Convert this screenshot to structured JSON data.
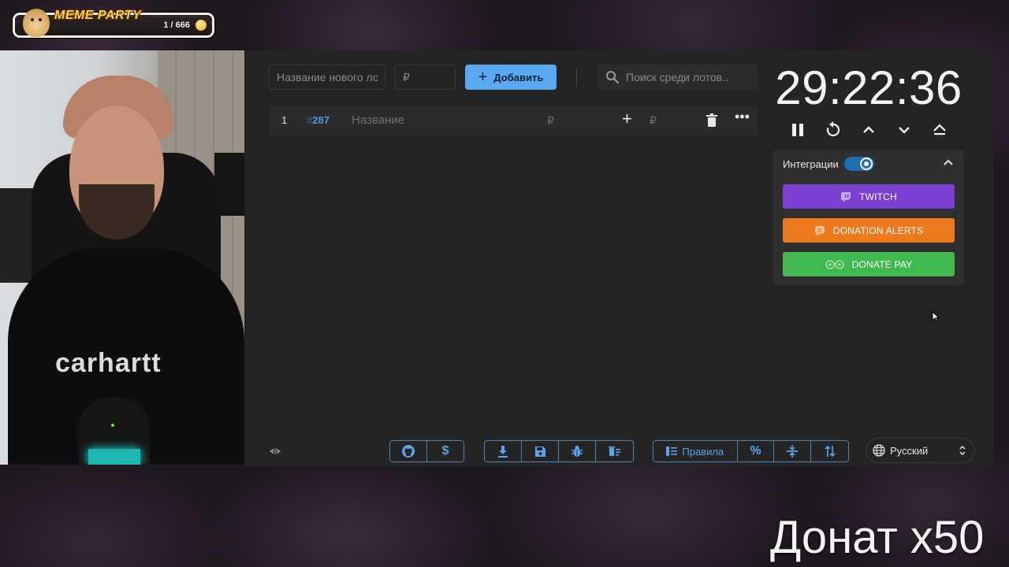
{
  "overlay": {
    "brand": "MEME PARTY",
    "counter": "1 / 666"
  },
  "webcam": {
    "shirt_logo": "carhartt"
  },
  "toolbar": {
    "name_placeholder": "Название нового лота",
    "price_placeholder": "₽",
    "add_label": "Добавить",
    "search_placeholder": "Поиск среди лотов.."
  },
  "lots": [
    {
      "number": "1",
      "id_hash": "#",
      "id": "287",
      "name_placeholder": "Название",
      "amount_placeholder": "₽",
      "add_amount_placeholder": "₽"
    }
  ],
  "timer": {
    "value": "29:22:36"
  },
  "integrations": {
    "title": "Интеграции",
    "enabled": true,
    "buttons": [
      {
        "label": "TWITCH",
        "color": "#7b3fd2"
      },
      {
        "label": "DONATION ALERTS",
        "color": "#ea7a1c"
      },
      {
        "label": "DONATE PAY",
        "color": "#3fb84f"
      }
    ]
  },
  "footer": {
    "rules_label": "Правила",
    "language": "Русский"
  },
  "caption": "Донат x50",
  "colors": {
    "accent": "#5aa9f0",
    "panel": "#242424",
    "link": "#5ba4ee"
  }
}
